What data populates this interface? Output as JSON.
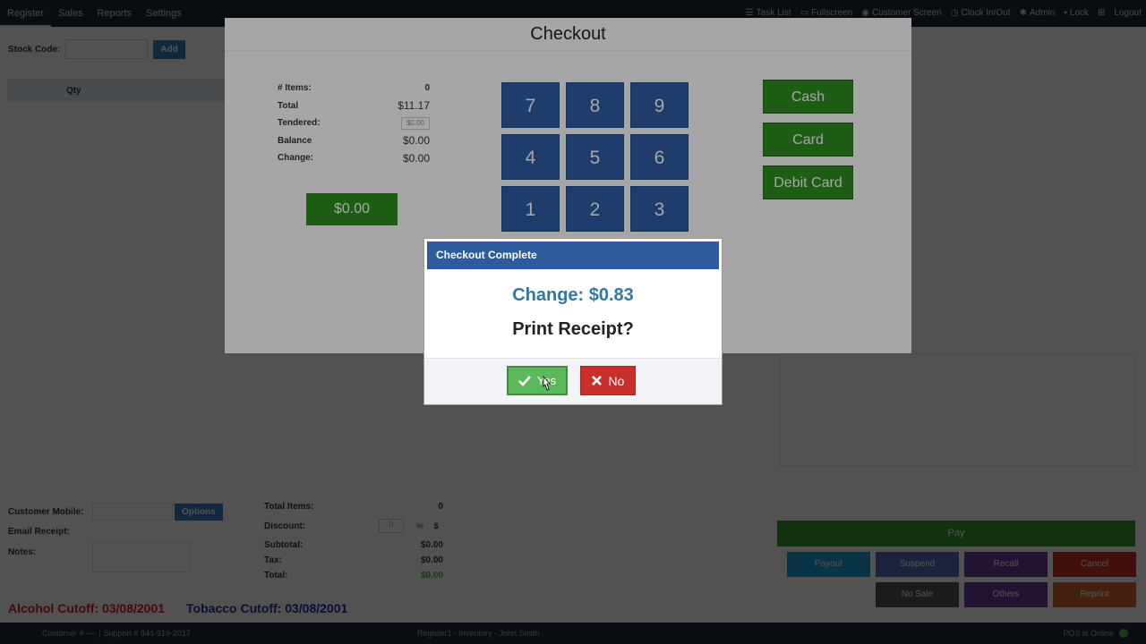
{
  "topnav": {
    "items": [
      "Register",
      "Sales",
      "Reports",
      "Settings"
    ],
    "right": {
      "task_list": "Task List",
      "fullscreen": "Fullscreen",
      "customer_screen": "Customer Screen",
      "clock": "Clock In/Out",
      "admin": "Admin",
      "lock": "Lock",
      "logout": "Logout"
    }
  },
  "register": {
    "stock_label": "Stock Code:",
    "add_label": "Add",
    "qty_header": "Qty",
    "customer_mobile_label": "Customer Mobile:",
    "options_label": "Options",
    "email_receipt_label": "Email Receipt:",
    "notes_label": "Notes:"
  },
  "totals": {
    "total_items_label": "Total Items:",
    "total_items_value": "0",
    "discount_label": "Discount:",
    "discount_value": "0",
    "discount_pct": "%",
    "discount_dollar": "$",
    "subtotal_label": "Subtotal:",
    "subtotal_value": "$0.00",
    "tax_label": "Tax:",
    "tax_value": "$0.00",
    "total_label": "Total:",
    "total_value": "$0.00"
  },
  "cutoffs": {
    "alcohol": "Alcohol Cutoff: 03/08/2001",
    "tobacco": "Tobacco Cutoff: 03/08/2001"
  },
  "actions": {
    "pay": "Pay",
    "payout": "Payout",
    "suspend": "Suspend",
    "recall": "Recall",
    "cancel": "Cancel",
    "nosale": "No Sale",
    "others": "Others",
    "reprint": "Reprint"
  },
  "statusbar": {
    "left": "Customer # ---- | Support # 844-919-2017",
    "middle": "Register1 - Inventory - John Smith",
    "right": "POS is Online"
  },
  "checkout": {
    "title": "Checkout",
    "items_label": "# Items:",
    "items_value": "0",
    "total_label": "Total",
    "total_value": "$11.17",
    "tendered_label": "Tendered:",
    "tendered_value": "$0.00",
    "balance_label": "Balance",
    "balance_value": "$0.00",
    "change_label": "Change:",
    "change_value": "$0.00",
    "amount_button": "$0.00",
    "keys": [
      "7",
      "8",
      "9",
      "4",
      "5",
      "6",
      "1",
      "2",
      "3"
    ],
    "methods": [
      "Cash",
      "Card",
      "Debit Card"
    ]
  },
  "dialog": {
    "title": "Checkout Complete",
    "change_text": "Change: $0.83",
    "prompt": "Print Receipt?",
    "yes_label": "Yes",
    "no_label": "No"
  },
  "colors": {
    "nav_bg": "#1e2a36",
    "dialog_header": "#2d5b9e",
    "change_text": "#2f7aa3",
    "keypad": "#2f5ea6",
    "pay_method": "#2f8f20",
    "yes": "#5cb85c",
    "no": "#c9302c"
  }
}
